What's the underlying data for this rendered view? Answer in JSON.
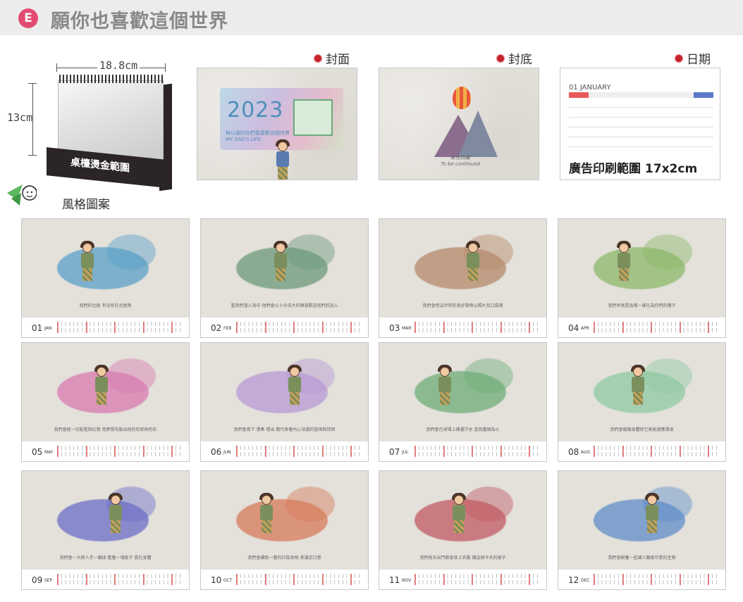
{
  "header": {
    "badge": "E",
    "title": "願你也喜歡這個世界"
  },
  "product": {
    "width_label": "18.8cm",
    "height_label": "13cm",
    "desk_label": "桌檯燙金範圍"
  },
  "style_label": "風格圖案",
  "sections": {
    "cover": "封面",
    "back": "封底",
    "date": "日期"
  },
  "cover": {
    "year": "2023",
    "subtitle_line1": "與以後的你們我喜歡這個世界",
    "subtitle_line2": "MY DAD's LIFE"
  },
  "back": {
    "text_line1": "未完待續",
    "text_line2": "To be continued"
  },
  "date_page": {
    "month_label": "01 JANUARY",
    "ad_text": "廣告印刷範圍 17x2cm"
  },
  "months": [
    {
      "num": "01",
      "abbr": "JAN",
      "caption": "我們的北極 有沒有在北極熊",
      "accent": "#5aa0c8"
    },
    {
      "num": "02",
      "abbr": "FEB",
      "caption": "當我們潛入海中 他們會以十分浩大的陣容歡迎我們的加入",
      "accent": "#6c9a7a"
    },
    {
      "num": "03",
      "abbr": "MAR",
      "caption": "我們會把這世界的美好事物以照片及口袋裡",
      "accent": "#b58a6a"
    },
    {
      "num": "04",
      "abbr": "APR",
      "caption": "我們早就是品嚐一樣在為你們的種子",
      "accent": "#8cb86a"
    },
    {
      "num": "05",
      "abbr": "MAY",
      "caption": "我們會經一切能看與幻想 用夢想勾勒出他的形狀與色彩",
      "accent": "#d87ab0"
    },
    {
      "num": "06",
      "abbr": "JUN",
      "caption": "我們會寫下 彈奏 唱出 都代表著內心深處的旋律與詩詞",
      "accent": "#b79ad6"
    },
    {
      "num": "07",
      "abbr": "JUL",
      "caption": "我們會在球場上揮灑汗水 直到盡頭為止",
      "accent": "#6fae78"
    },
    {
      "num": "08",
      "abbr": "AUG",
      "caption": "我們會鍛鍊身體使它更能適應環境",
      "accent": "#8fcaa3"
    },
    {
      "num": "09",
      "abbr": "SEP",
      "caption": "我們會一大群人手一顆球 籃著一塊板子 震在身體",
      "accent": "#6b6ec8"
    },
    {
      "num": "10",
      "abbr": "OCT",
      "caption": "我們會攝取一層的拉拔食物 來滿足口感",
      "accent": "#d77b5a"
    },
    {
      "num": "11",
      "abbr": "NOV",
      "caption": "我們每天出門都會穿上衣服 讓這個今天的樣子",
      "accent": "#c25a64"
    },
    {
      "num": "12",
      "abbr": "DEC",
      "caption": "我們會飼養一些讓人類更可愛的生物",
      "accent": "#5f8ec8"
    }
  ]
}
